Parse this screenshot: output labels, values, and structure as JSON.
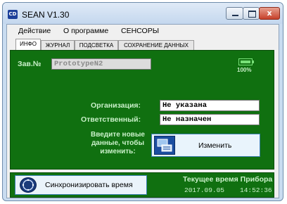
{
  "window": {
    "icon_text": "CD",
    "title": "SEAN V1.30",
    "min_label": "",
    "max_label": "",
    "close_label": "x"
  },
  "menu": [
    "Действие",
    "О программе",
    "СЕНСОРЫ"
  ],
  "tabs": [
    "ИНФО",
    "ЖУРНАЛ",
    "ПОДСВЕТКА",
    "СОХРАНЕНИЕ ДАННЫХ"
  ],
  "active_tab": "ИНФО",
  "info": {
    "serial_label": "Зав.№",
    "serial_value": "PrototypeN2",
    "battery_pct": "100%",
    "battery_level": 1.0,
    "org_label": "Организация:",
    "org_value": "Не указана",
    "resp_label": "Ответственный:",
    "resp_value": "Не назначен",
    "prompt_line1": "Введите новые",
    "prompt_line2": "данные, чтобы",
    "prompt_line3": "изменить:",
    "change_button": "Изменить"
  },
  "bottom": {
    "sync_button": "Синхронизировать время",
    "time_title": "Текущее время Прибора",
    "date": "2017.09.05",
    "time": "14:52:36"
  },
  "colors": {
    "panel_green": "#107010",
    "text_green": "#c9f0c9",
    "battery_green": "#78e078"
  }
}
